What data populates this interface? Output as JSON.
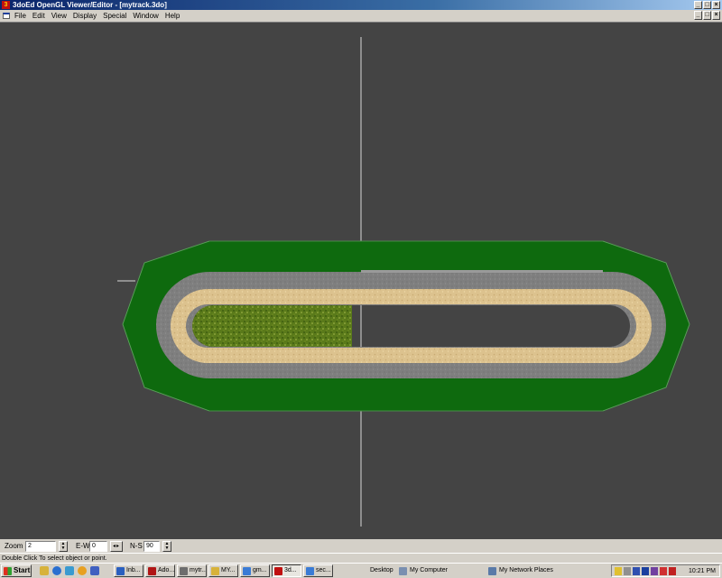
{
  "window": {
    "app_icon": "3",
    "title": "3doEd OpenGL Viewer/Editor - [mytrack.3do]",
    "buttons": {
      "minimize": "_",
      "maximize": "□",
      "close": "×"
    }
  },
  "menu": {
    "items": [
      "File",
      "Edit",
      "View",
      "Display",
      "Special",
      "Window",
      "Help"
    ],
    "accent": "#2040a0"
  },
  "viewport": {
    "background": "#444444",
    "track_colors": {
      "grass": "#0e6a0e",
      "road": "#7f7f7f",
      "sand": "#dcc28e",
      "infield": "#5a7a1a"
    }
  },
  "zoombar": {
    "zoom_label": "Zoom",
    "zoom_value": "2",
    "ew_label": "E-W",
    "ew_value": "0",
    "ns_label": "N-S",
    "ns_value": "90"
  },
  "status": {
    "text": "Double Click To select object or point."
  },
  "taskbar": {
    "start_label": "Start",
    "tasks": [
      {
        "label": "Inb...",
        "icon": "mail-icon",
        "color": "#2a5fbf"
      },
      {
        "label": "Ado...",
        "icon": "acrobat-icon",
        "color": "#b01515"
      },
      {
        "label": "mytr...",
        "icon": "document-icon",
        "color": "#6d6d6d"
      },
      {
        "label": "MY...",
        "icon": "folder-icon",
        "color": "#d7b23a"
      },
      {
        "label": "gm...",
        "icon": "window-icon",
        "color": "#3a7bd5"
      },
      {
        "label": "3d...",
        "icon": "app-3d-icon",
        "color": "#c01010"
      },
      {
        "label": "sec...",
        "icon": "window-icon",
        "color": "#3a7bd5"
      }
    ],
    "desktop_toolbar": {
      "desktop": "Desktop",
      "my_computer": "My Computer",
      "network": "My Network Places"
    },
    "clock": "10:21 PM"
  }
}
